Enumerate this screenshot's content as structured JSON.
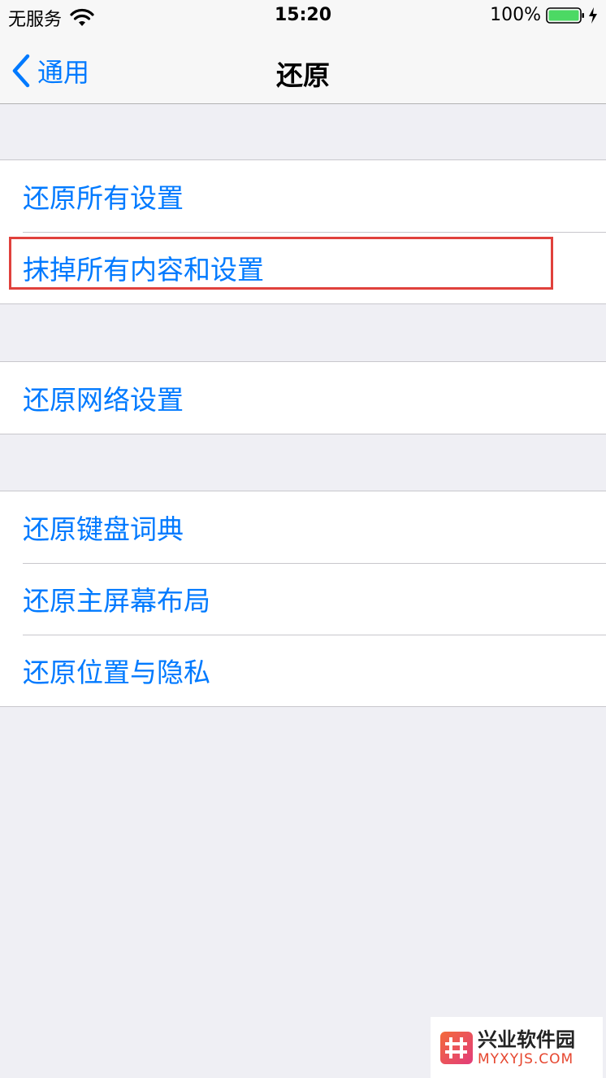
{
  "status_bar": {
    "carrier": "无服务",
    "time": "15:20",
    "battery_percent": "100%",
    "battery_level": 1.0,
    "icons": [
      "wifi-icon",
      "battery-icon",
      "charging-bolt-icon"
    ]
  },
  "nav": {
    "back_label": "通用",
    "title": "还原"
  },
  "groups": [
    {
      "items": [
        "还原所有设置",
        "抹掉所有内容和设置"
      ]
    },
    {
      "items": [
        "还原网络设置"
      ]
    },
    {
      "items": [
        "还原键盘词典",
        "还原主屏幕布局",
        "还原位置与隐私"
      ]
    }
  ],
  "watermark": {
    "cn": "兴业软件园",
    "en": "MYXYJS.COM"
  },
  "colors": {
    "accent": "#007aff",
    "background": "#efeff4",
    "highlight": "#e0413c",
    "battery": "#4cd964"
  }
}
